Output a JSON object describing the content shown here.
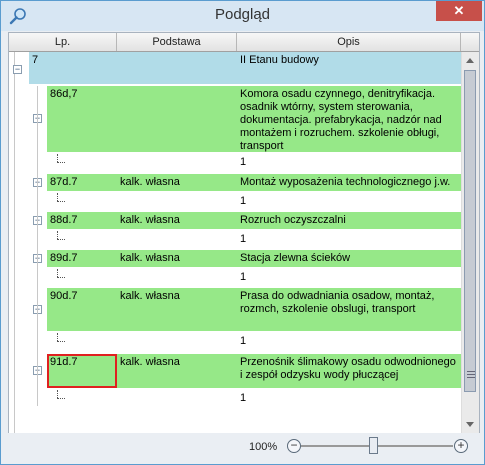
{
  "window": {
    "title": "Podgląd",
    "close_symbol": "✕"
  },
  "columns": [
    "Lp.",
    "Podstawa",
    "Opis"
  ],
  "rows": [
    {
      "lp": "7",
      "podstawa": "",
      "opis": "II Etanu budowy"
    },
    {
      "lp": "86d,7",
      "podstawa": "",
      "opis": "Komora osadu czynnego, denitryfikacja. osadnik wtórny, system sterowania, dokumentacja. prefabrykacja, nadzór nad montażem i rozruchem. szkolenie obługi, transport"
    },
    {
      "lp": "",
      "podstawa": "",
      "opis": "1"
    },
    {
      "lp": "87d.7",
      "podstawa": "kalk. własna",
      "opis": "Montaż wyposażenia technologicznego j.w."
    },
    {
      "lp": "",
      "podstawa": "",
      "opis": "1"
    },
    {
      "lp": "88d.7",
      "podstawa": "kalk. własna",
      "opis": "Rozruch oczyszczalni"
    },
    {
      "lp": "",
      "podstawa": "",
      "opis": "1"
    },
    {
      "lp": "89d.7",
      "podstawa": "kalk. własna",
      "opis": "Stacja zlewna ścieków"
    },
    {
      "lp": "",
      "podstawa": "",
      "opis": "1"
    },
    {
      "lp": "90d.7",
      "podstawa": "kalk. własna",
      "opis": "Prasa do odwadniania osadow, montaż, rozmch, szkolenie obslugi, transport"
    },
    {
      "lp": "",
      "podstawa": "",
      "opis": "1"
    },
    {
      "lp": "91d.7",
      "podstawa": "kalk. własna",
      "opis": "Przenośnik ślimakowy osadu odwodnionego i zespół odzysku wody płuczącej"
    },
    {
      "lp": "",
      "podstawa": "",
      "opis": "1"
    }
  ],
  "status": {
    "zoom": "100%",
    "zoom_level": 0.5
  },
  "icons": {
    "title": "magnifier-icon",
    "zoom_out": "minus-icon",
    "zoom_in": "plus-icon"
  },
  "colors": {
    "group": "#b1dce8",
    "item": "#96e888",
    "selection": "#e02020"
  }
}
